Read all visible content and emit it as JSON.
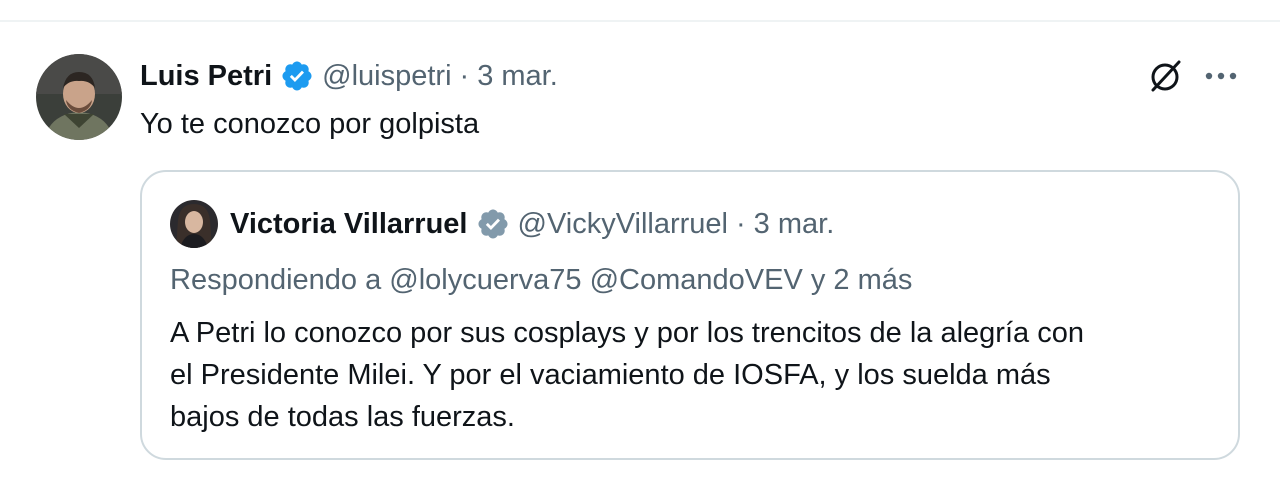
{
  "tweet": {
    "author_name": "Luis Petri",
    "handle": "@luispetri",
    "separator": "·",
    "date": "3 mar.",
    "text": "Yo te conozco por golpista",
    "verified_icon": "verified-badge-blue",
    "grok_icon": "grok-slash-icon",
    "more_icon": "more-dots-icon"
  },
  "quote": {
    "author_name": "Victoria Villarruel",
    "handle": "@VickyVillarruel",
    "separator": "·",
    "date": "3 mar.",
    "verified_icon": "verified-badge-gray",
    "replying_to": "Respondiendo a @lolycuerva75 @ComandoVEV y 2 más",
    "body_lines": [
      "A Petri lo conozco por sus cosplays y por los trencitos de la alegría con",
      "el Presidente Milei. Y por el vaciamiento de IOSFA, y los suelda más",
      "bajos de todas las fuerzas."
    ]
  },
  "colors": {
    "text_primary": "#0f1419",
    "text_muted": "#536471",
    "verified_blue": "#1d9bf0",
    "verified_gray": "#829aab",
    "border": "#cfd9de"
  }
}
